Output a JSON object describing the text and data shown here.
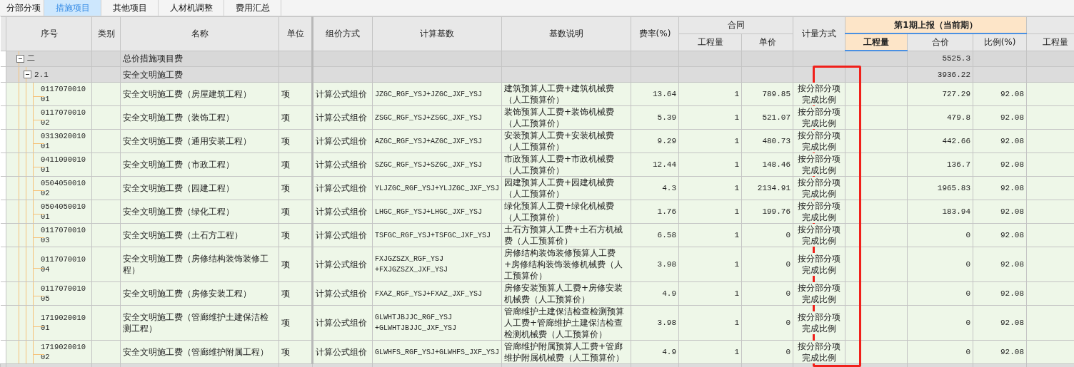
{
  "tabs": [
    {
      "label": "分部分项",
      "selected": false
    },
    {
      "label": "措施项目",
      "selected": true
    },
    {
      "label": "其他项目",
      "selected": false
    },
    {
      "label": "人材机调整",
      "selected": false
    },
    {
      "label": "费用汇总",
      "selected": false
    }
  ],
  "columns": [
    {
      "label": "序号"
    },
    {
      "label": "类别"
    },
    {
      "label": "名称"
    },
    {
      "label": "单位"
    },
    {
      "label": "组价方式"
    },
    {
      "label": "计算基数"
    },
    {
      "label": "基数说明"
    },
    {
      "label": "费率(%)"
    },
    {
      "label": "合同",
      "current": false,
      "children": [
        {
          "label": "工程量",
          "selected": false
        },
        {
          "label": "单价",
          "selected": false
        }
      ]
    },
    {
      "label": "计量方式"
    },
    {
      "label": "第1期上报（当前期）",
      "current": true,
      "children": [
        {
          "label": "工程量",
          "selected": true
        },
        {
          "label": "合价",
          "selected": false
        },
        {
          "label": "比例(%)",
          "selected": false
        }
      ]
    },
    {
      "current": false,
      "children": [
        {
          "label": "工程量",
          "selected": false
        }
      ]
    }
  ],
  "rows": [
    {
      "code": "二",
      "name": "总价措施项目费",
      "amount": "5525.3",
      "expanded": true,
      "children": [
        {
          "code": "2.1",
          "name": "安全文明施工费",
          "amount": "3936.22",
          "expanded": true,
          "children": [
            {
              "code": "011707001001",
              "name": "安全文明施工费（房屋建筑工程）",
              "unit": "项",
              "pricing_method": "计算公式组价",
              "calc_base": "JZGC_RGF_YSJ+JZGC_JXF_YSJ",
              "base_description": "建筑预算人工费+建筑机械费（人工预算价）",
              "rate": "13.64",
              "contract_quantity": "1",
              "contract_unit_price": "789.85",
              "measure_method": "按分部分项完成比例",
              "amount": "727.29",
              "ratio": "92.08"
            },
            {
              "code": "011707001002",
              "name": "安全文明施工费（装饰工程）",
              "unit": "项",
              "pricing_method": "计算公式组价",
              "calc_base": "ZSGC_RGF_YSJ+ZSGC_JXF_YSJ",
              "base_description": "装饰预算人工费+装饰机械费（人工预算价）",
              "rate": "5.39",
              "contract_quantity": "1",
              "contract_unit_price": "521.07",
              "measure_method": "按分部分项完成比例",
              "amount": "479.8",
              "ratio": "92.08"
            },
            {
              "code": "031302001001",
              "name": "安全文明施工费（通用安装工程）",
              "unit": "项",
              "pricing_method": "计算公式组价",
              "calc_base": "AZGC_RGF_YSJ+AZGC_JXF_YSJ",
              "base_description": "安装预算人工费+安装机械费（人工预算价）",
              "rate": "9.29",
              "contract_quantity": "1",
              "contract_unit_price": "480.73",
              "measure_method": "按分部分项完成比例",
              "amount": "442.66",
              "ratio": "92.08"
            },
            {
              "code": "041109001001",
              "name": "安全文明施工费（市政工程）",
              "unit": "项",
              "pricing_method": "计算公式组价",
              "calc_base": "SZGC_RGF_YSJ+SZGC_JXF_YSJ",
              "base_description": "市政预算人工费+市政机械费（人工预算价）",
              "rate": "12.44",
              "contract_quantity": "1",
              "contract_unit_price": "148.46",
              "measure_method": "按分部分项完成比例",
              "amount": "136.7",
              "ratio": "92.08"
            },
            {
              "code": "050405001002",
              "name": "安全文明施工费（园建工程）",
              "unit": "项",
              "pricing_method": "计算公式组价",
              "calc_base": "YLJZGC_RGF_YSJ+YLJZGC_JXF_YSJ",
              "base_description": "园建预算人工费+园建机械费（人工预算价）",
              "rate": "4.3",
              "contract_quantity": "1",
              "contract_unit_price": "2134.91",
              "measure_method": "按分部分项完成比例",
              "amount": "1965.83",
              "ratio": "92.08"
            },
            {
              "code": "050405001001",
              "name": "安全文明施工费（绿化工程）",
              "unit": "项",
              "pricing_method": "计算公式组价",
              "calc_base": "LHGC_RGF_YSJ+LHGC_JXF_YSJ",
              "base_description": "绿化预算人工费+绿化机械费（人工预算价）",
              "rate": "1.76",
              "contract_quantity": "1",
              "contract_unit_price": "199.76",
              "measure_method": "按分部分项完成比例",
              "amount": "183.94",
              "ratio": "92.08"
            },
            {
              "code": "011707001003",
              "name": "安全文明施工费（土石方工程）",
              "unit": "项",
              "pricing_method": "计算公式组价",
              "calc_base": "TSFGC_RGF_YSJ+TSFGC_JXF_YSJ",
              "base_description": "土石方预算人工费+土石方机械费（人工预算价）",
              "rate": "6.58",
              "contract_quantity": "1",
              "contract_unit_price": "0",
              "measure_method": "按分部分项完成比例",
              "amount": "0",
              "ratio": "92.08"
            },
            {
              "code": "011707001004",
              "name": "安全文明施工费（房修结构装饰装修工程）",
              "unit": "项",
              "pricing_method": "计算公式组价",
              "calc_base": "FXJGZSZX_RGF_YSJ +FXJGZSZX_JXF_YSJ",
              "base_description": "房修结构装饰装修预算人工费+房修结构装饰装修机械费（人工预算价）",
              "rate": "3.98",
              "contract_quantity": "1",
              "contract_unit_price": "0",
              "measure_method": "按分部分项完成比例",
              "amount": "0",
              "ratio": "92.08"
            },
            {
              "code": "011707001005",
              "name": "安全文明施工费（房修安装工程）",
              "unit": "项",
              "pricing_method": "计算公式组价",
              "calc_base": "FXAZ_RGF_YSJ+FXAZ_JXF_YSJ",
              "base_description": "房修安装预算人工费+房修安装机械费（人工预算价）",
              "rate": "4.9",
              "contract_quantity": "1",
              "contract_unit_price": "0",
              "measure_method": "按分部分项完成比例",
              "amount": "0",
              "ratio": "92.08"
            },
            {
              "code": "171902001001",
              "name": "安全文明施工费（管廊维护土建保洁检测工程）",
              "unit": "项",
              "pricing_method": "计算公式组价",
              "calc_base": "GLWHTJBJJC_RGF_YSJ +GLWHTJBJJC_JXF_YSJ",
              "base_description": "管廊维护土建保洁检查检测预算人工费+管廊维护土建保洁检查检测机械费（人工预算价）",
              "rate": "3.98",
              "contract_quantity": "1",
              "contract_unit_price": "0",
              "measure_method": "按分部分项完成比例",
              "amount": "0",
              "ratio": "92.08"
            },
            {
              "code": "171902001002",
              "name": "安全文明施工费（管廊维护附属工程）",
              "unit": "项",
              "pricing_method": "计算公式组价",
              "calc_base": "GLWHFS_RGF_YSJ+GLWHFS_JXF_YSJ",
              "base_description": "管廊维护附属预算人工费+管廊维护附属机械费（人工预算价）",
              "rate": "4.9",
              "contract_quantity": "1",
              "contract_unit_price": "0",
              "measure_method": "按分部分项完成比例",
              "amount": "0",
              "ratio": "92.08"
            }
          ]
        }
      ]
    }
  ],
  "highlight_frame": {
    "shown": true
  }
}
